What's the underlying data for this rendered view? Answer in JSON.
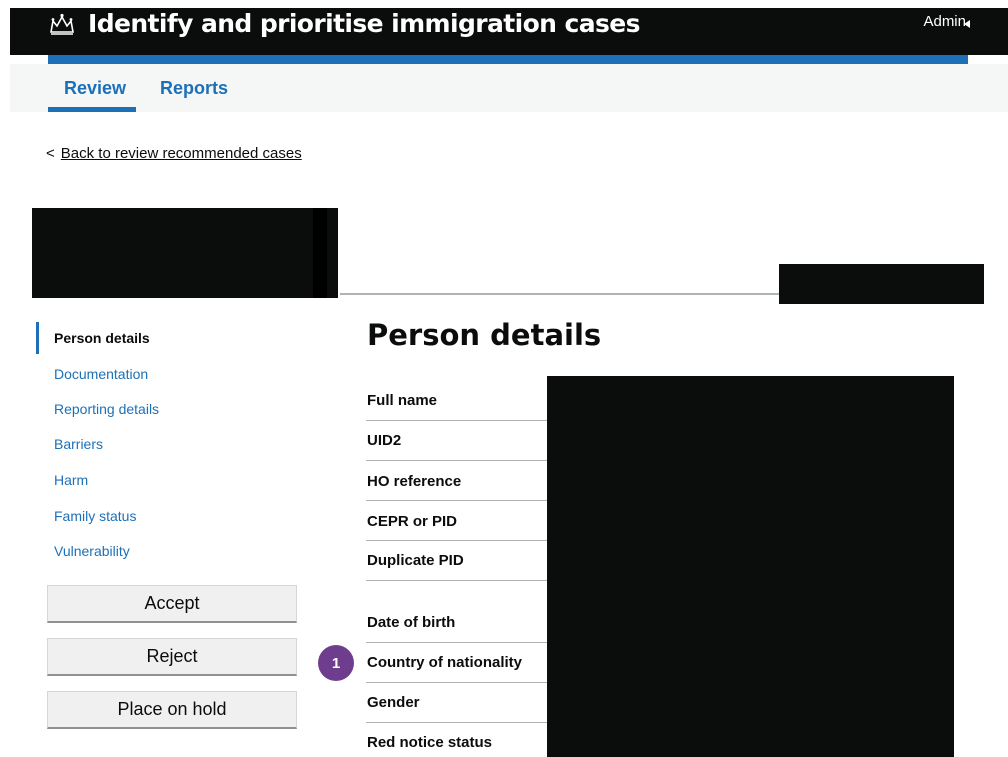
{
  "header": {
    "title": "Identify and prioritise immigration cases",
    "user_menu": "Admin",
    "crown_icon": "crown-icon",
    "brand_color": "#1d70b8"
  },
  "tabs": [
    {
      "label": "Review",
      "active": true
    },
    {
      "label": "Reports",
      "active": false
    }
  ],
  "back_link": {
    "chevron": "<",
    "label": "Back to review recommended cases"
  },
  "sidebar": {
    "items": [
      {
        "label": "Person details",
        "active": true
      },
      {
        "label": "Documentation",
        "active": false
      },
      {
        "label": "Reporting details",
        "active": false
      },
      {
        "label": "Barriers",
        "active": false
      },
      {
        "label": "Harm",
        "active": false
      },
      {
        "label": "Family status",
        "active": false
      },
      {
        "label": "Vulnerability",
        "active": false
      }
    ],
    "actions": {
      "accept": "Accept",
      "reject": "Reject",
      "hold": "Place on hold"
    }
  },
  "section": {
    "title": "Person details",
    "rows": [
      {
        "label": "Full name"
      },
      {
        "label": "UID2"
      },
      {
        "label": "HO reference"
      },
      {
        "label": "CEPR or PID"
      },
      {
        "label": "Duplicate PID"
      },
      {
        "label": "Date of birth"
      },
      {
        "label": "Country of nationality"
      },
      {
        "label": "Gender"
      },
      {
        "label": "Red notice status"
      }
    ]
  },
  "annotation": {
    "badge": "1",
    "color": "#6f3d8e"
  }
}
